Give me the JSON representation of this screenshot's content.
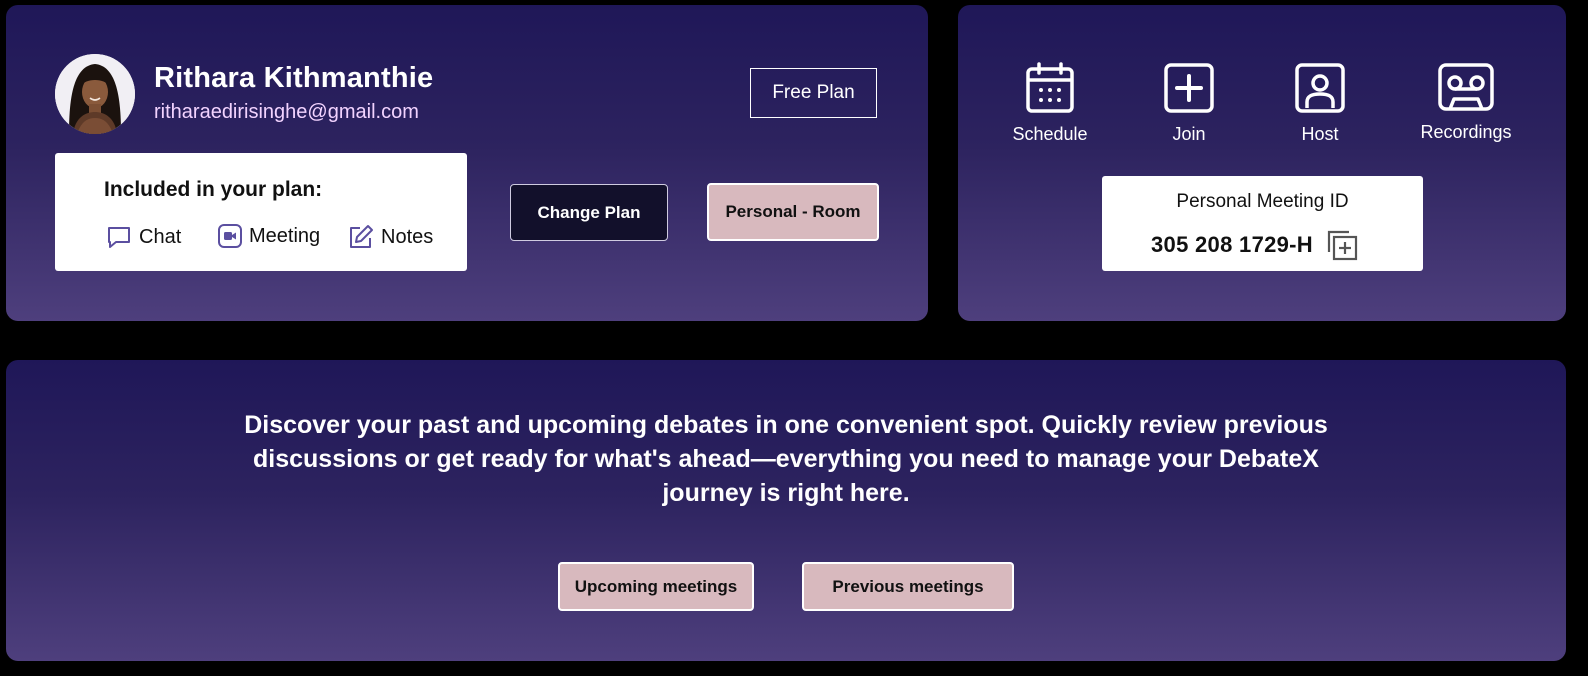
{
  "profile": {
    "name": "Rithara Kithmanthie",
    "email": "ritharaedirisinghe@gmail.com",
    "plan_badge": "Free Plan",
    "included_title": "Included in your plan:",
    "features": [
      {
        "label": "Chat",
        "icon": "chat-icon"
      },
      {
        "label": "Meeting",
        "icon": "video-camera-icon"
      },
      {
        "label": "Notes",
        "icon": "edit-note-icon"
      }
    ],
    "change_plan_label": "Change Plan",
    "personal_room_label": "Personal - Room"
  },
  "actions": {
    "items": [
      {
        "label": "Schedule",
        "icon": "calendar-icon"
      },
      {
        "label": "Join",
        "icon": "plus-square-icon"
      },
      {
        "label": "Host",
        "icon": "user-portrait-icon"
      },
      {
        "label": "Recordings",
        "icon": "cassette-icon"
      }
    ],
    "meeting_id_label": "Personal Meeting ID",
    "meeting_id": "305 208 1729-H"
  },
  "debates": {
    "description": "Discover your past and upcoming debates in one convenient spot. Quickly review previous discussions or get ready for what's ahead—everything you need to manage your DebateX journey is right here.",
    "upcoming_label": "Upcoming meetings",
    "previous_label": "Previous meetings"
  },
  "colors": {
    "panel_top": "#1f1758",
    "panel_bottom": "#4e3f7d",
    "pink_button": "#d8b9be",
    "dark_button": "#12102b",
    "email": "#f2d3ff",
    "icon_accent": "#5b4fa0"
  }
}
